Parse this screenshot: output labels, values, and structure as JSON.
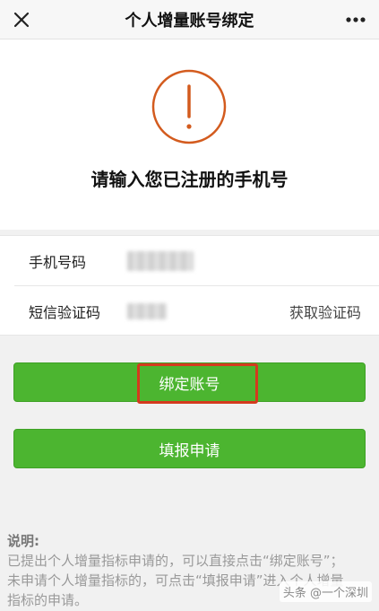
{
  "header": {
    "title": "个人增量账号绑定",
    "close_icon": "close-icon",
    "more_icon": "more-icon"
  },
  "hero": {
    "icon": "warning-icon",
    "icon_color": "#d35b1e",
    "instruction": "请输入您已注册的手机号"
  },
  "form": {
    "phone_label": "手机号码",
    "code_label": "短信验证码",
    "get_code_label": "获取验证码"
  },
  "buttons": {
    "bind_label": "绑定账号",
    "apply_label": "填报申请",
    "color": "#4cb530",
    "highlight_color": "#d43a1e"
  },
  "note": {
    "title": "说明:",
    "line1": "已提出个人增量指标申请的，可以直接点击“绑定账号”；",
    "line2": "未申请个人增量指标的，可点击“填报申请”进入个人增量",
    "line3": "指标的申请。"
  },
  "watermark": "头条 @一个深圳"
}
